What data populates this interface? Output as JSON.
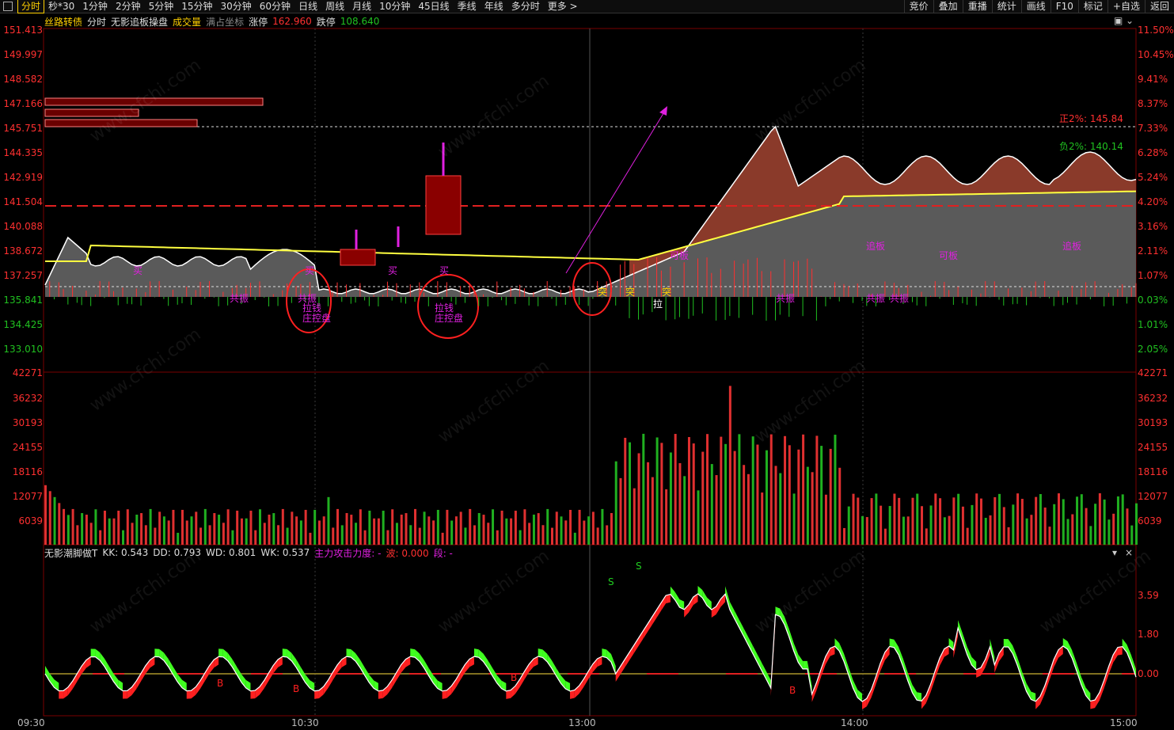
{
  "toolbar": {
    "tabs": [
      "分时",
      "秒*30",
      "1分钟",
      "2分钟",
      "5分钟",
      "15分钟",
      "30分钟",
      "60分钟",
      "日线",
      "周线",
      "月线",
      "10分钟",
      "45日线",
      "季线",
      "年线",
      "多分时",
      "更多 >"
    ],
    "right_tools": [
      "竞价",
      "叠加",
      "重播",
      "统计",
      "画线",
      "F10",
      "标记",
      "+自选",
      "返回"
    ]
  },
  "info": {
    "stock_name": "丝路转债",
    "mode": "分时",
    "indicator_name": "无影追板操盘",
    "volume_label": "成交量",
    "fullscreen_label": "满占坐标",
    "limit_up_label": "涨停",
    "limit_up_value": "162.960",
    "limit_down_label": "跌停",
    "limit_down_value": "108.640"
  },
  "price_axis_left": [
    "151.413",
    "149.997",
    "148.582",
    "147.166",
    "145.751",
    "144.335",
    "142.919",
    "141.504",
    "140.088",
    "138.672",
    "137.257",
    "135.841",
    "134.425",
    "133.010"
  ],
  "price_axis_right": [
    "11.50%",
    "10.45%",
    "9.41%",
    "8.37%",
    "7.33%",
    "6.28%",
    "5.24%",
    "4.20%",
    "3.16%",
    "2.11%",
    "1.07%",
    "0.03%",
    "1.01%",
    "2.05%"
  ],
  "volume_axis": [
    "42271",
    "36232",
    "30193",
    "24155",
    "18116",
    "12077",
    "6039"
  ],
  "indicator_axis": [
    "3.59",
    "1.80",
    "0.00"
  ],
  "time_axis": [
    "09:30",
    "10:30",
    "13:00",
    "14:00",
    "15:00"
  ],
  "annotations": {
    "positive_level": "正2%: 145.84",
    "negative_level": "负2%: 140.14",
    "resonance": "共振",
    "buy": "买",
    "pull": "拉",
    "breakout": "突",
    "can_board": "可板",
    "chase_board": "追板",
    "pull_money": "拉钱",
    "controlled": "庄控盘",
    "sell_mark": "S",
    "buy_mark": "B"
  },
  "indicator_bar": {
    "name": "无影潮脚做T",
    "kk": "KK: 0.543",
    "dd": "DD: 0.793",
    "wd": "WD: 0.801",
    "wk": "WK: 0.537",
    "force": "主力攻击力度: -",
    "wave": "波: 0.000",
    "segment": "段: -"
  },
  "watermark": "www.cfchi.com",
  "colors": {
    "up": "#ff3030",
    "down": "#20c020",
    "avg": "#ffff40",
    "price": "#ffffff",
    "accent": "#ffd000",
    "magenta": "#e020e0"
  }
}
